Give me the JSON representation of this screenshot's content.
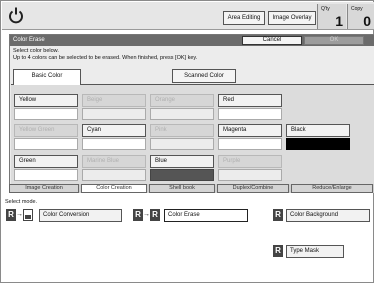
{
  "topbar": {
    "area_editing": "Area Editing",
    "image_overlay": "Image Overlay",
    "qty_label": "Q'ty",
    "qty_value": "1",
    "copy_label": "Copy",
    "copy_value": "0"
  },
  "dialog": {
    "title": "Color Erase",
    "cancel": "Cancel",
    "ok": "OK",
    "instruction1": "Select color below.",
    "instruction2": "Up to 4 colors can be selected to be erased. When finished,  press [OK] key.",
    "tab_basic": "Basic Color",
    "tab_scanned": "Scanned Color",
    "colors": [
      {
        "label": "Yellow",
        "enabled": true,
        "swatch": "#ffffff"
      },
      {
        "label": "Beige",
        "enabled": false,
        "swatch": "#ececec"
      },
      {
        "label": "Orange",
        "enabled": false,
        "swatch": "#ececec"
      },
      {
        "label": "Red",
        "enabled": true,
        "swatch": "#ffffff"
      },
      {
        "label": "Yellow Green",
        "enabled": false,
        "swatch": "#ffffff"
      },
      {
        "label": "Cyan",
        "enabled": true,
        "swatch": "#ffffff"
      },
      {
        "label": "Pink",
        "enabled": false,
        "swatch": "#ececec"
      },
      {
        "label": "Magenta",
        "enabled": true,
        "swatch": "#ffffff"
      },
      {
        "label": "Black",
        "enabled": true,
        "swatch": "#000000"
      },
      {
        "label": "Green",
        "enabled": true,
        "swatch": "#ffffff"
      },
      {
        "label": "Marine Blue",
        "enabled": false,
        "swatch": "#ececec"
      },
      {
        "label": "Blue",
        "enabled": true,
        "swatch": "#555555"
      },
      {
        "label": "Purple",
        "enabled": false,
        "swatch": "#ececec"
      }
    ]
  },
  "mode_tabs": [
    "Image Creation",
    "Color Creation",
    "Shell book",
    "Duplex/Combine",
    "Reduce/Enlarge"
  ],
  "select_mode": "Select mode.",
  "modes": {
    "color_conversion": "Color Conversion",
    "color_erase": "Color Erase",
    "color_background": "Color Background",
    "type_mask": "Type Mask",
    "r_glyph": "R"
  },
  "colors": {
    "title_bar": "#6b6b6b",
    "disabled_text": "#b0b0b0"
  }
}
